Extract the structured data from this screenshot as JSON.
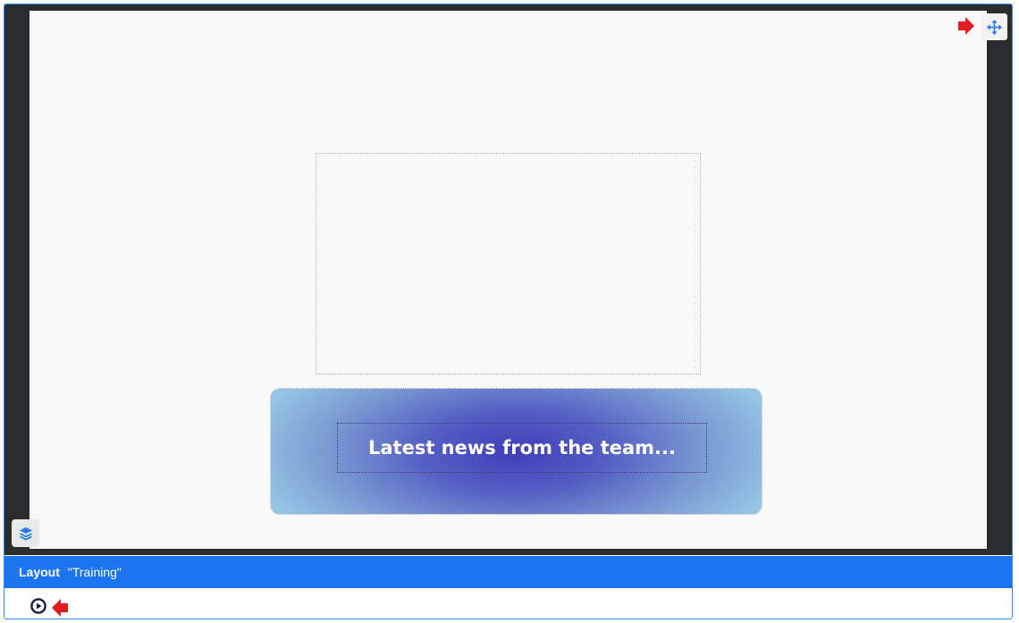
{
  "banner": {
    "text": "Latest news from the team..."
  },
  "status_bar": {
    "label": "Layout",
    "layout_name": "\"Training\""
  },
  "icons": {
    "move": "move-arrows-icon",
    "layers": "layers-icon",
    "play": "play-circle-icon",
    "hint_right": "red-arrow-right-icon",
    "hint_left": "red-arrow-left-icon"
  },
  "colors": {
    "accent": "#1c74ee",
    "stage_background": "#2b2c2e",
    "canvas_background": "#f8f8f8",
    "hint_arrow": "#e21b23",
    "banner_center": "#3f3eb9",
    "banner_edge": "#95c5e4"
  }
}
